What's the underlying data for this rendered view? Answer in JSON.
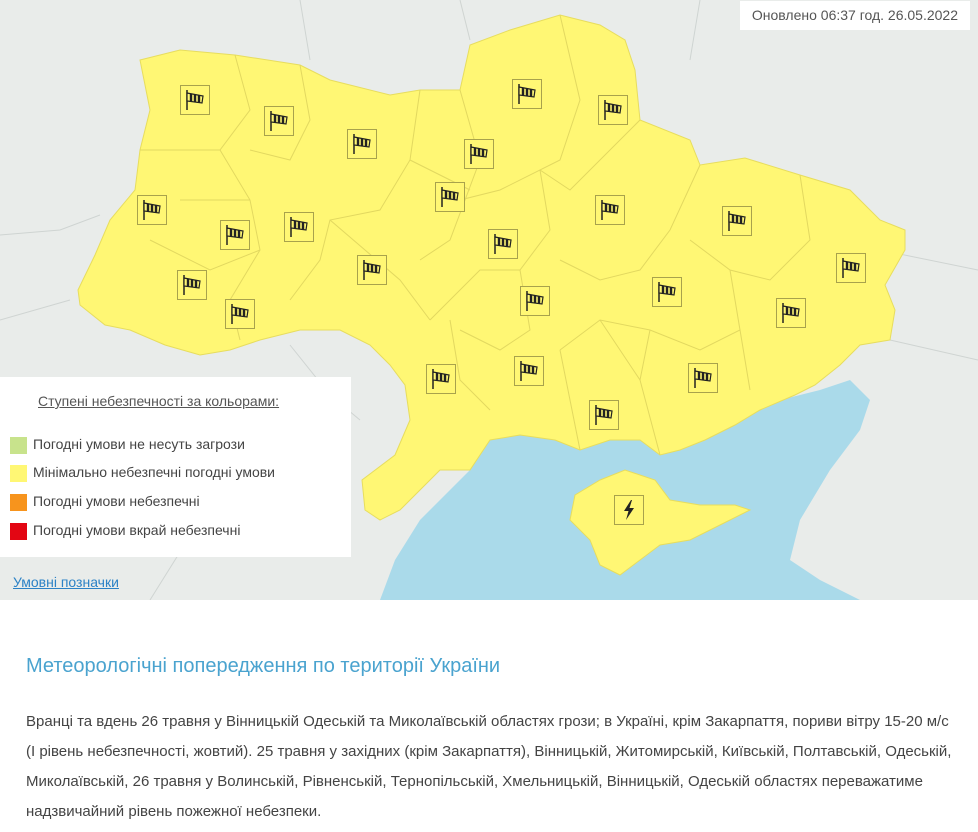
{
  "header": {
    "updated_text": "Оновлено 06:37 год. 26.05.2022"
  },
  "colors": {
    "ukraine_fill": "#fff774",
    "sea": "#aadaea",
    "no_threat": "#c8e38c",
    "minimal": "#fff774",
    "dangerous": "#f7941d",
    "very_dangerous": "#e30613",
    "link": "#2c82c6",
    "section_title": "#4aa3cf"
  },
  "map": {
    "icons": [
      {
        "type": "wind-icon"
      },
      {
        "type": "wind-icon"
      },
      {
        "type": "wind-icon"
      },
      {
        "type": "wind-icon"
      },
      {
        "type": "wind-icon"
      },
      {
        "type": "wind-icon"
      },
      {
        "type": "wind-icon"
      },
      {
        "type": "wind-icon"
      },
      {
        "type": "wind-icon"
      },
      {
        "type": "wind-icon"
      },
      {
        "type": "wind-icon"
      },
      {
        "type": "wind-icon"
      },
      {
        "type": "wind-icon"
      },
      {
        "type": "wind-icon"
      },
      {
        "type": "wind-icon"
      },
      {
        "type": "wind-icon"
      },
      {
        "type": "wind-icon"
      },
      {
        "type": "wind-icon"
      },
      {
        "type": "wind-icon"
      },
      {
        "type": "wind-icon"
      },
      {
        "type": "wind-icon"
      },
      {
        "type": "wind-icon"
      },
      {
        "type": "wind-icon"
      },
      {
        "type": "wind-icon"
      },
      {
        "type": "thunderstorm-icon"
      }
    ]
  },
  "legend": {
    "title": "Ступені небезпечності за кольорами:",
    "items": [
      {
        "label": "Погодні умови не несуть загрози",
        "color": "#c8e38c"
      },
      {
        "label": "Мінімально небезпечні погодні умови",
        "color": "#fff774"
      },
      {
        "label": "Погодні умови небезпечні",
        "color": "#f7941d"
      },
      {
        "label": "Погодні умови вкрай небезпечні",
        "color": "#e30613"
      }
    ],
    "symbols_link": "Умовні позначки"
  },
  "content": {
    "title": "Метеорологічні попередження по території України",
    "body": "Вранці та вдень 26 травня у Вінницькій Одеській та Миколаївській областях грози; в Україні, крім Закарпаття, пориви вітру 15-20 м/с (І рівень небезпечності, жовтий). 25 травня у західних (крім Закарпаття), Вінницькій, Житомирській, Київській, Полтавській, Одеській, Миколаївській, 26 травня у Волинській, Рівненській, Тернопільській, Хмельницькій, Вінницькій, Одеській областях переважатиме надзвичайний рівень пожежної небезпеки."
  }
}
